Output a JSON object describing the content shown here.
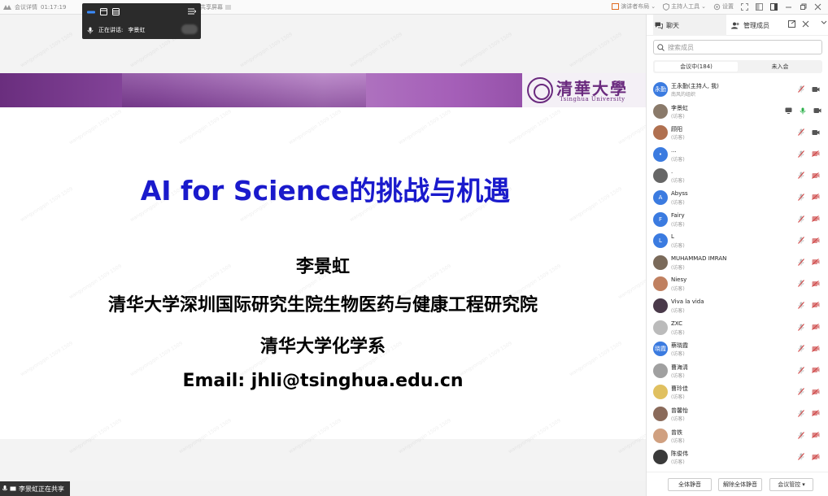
{
  "topbar": {
    "meeting_label": "会议详情",
    "timer": "01:17:19",
    "share_label": "共享屏幕",
    "layout_label": "演讲者布局",
    "host_tools_label": "主持人工具",
    "settings_label": "设置"
  },
  "speaker": {
    "label": "正在讲话:",
    "name": "李景虹"
  },
  "slide": {
    "title": "AI for Science的挑战与机遇",
    "author": "李景虹",
    "affiliation1": "清华大学深圳国际研究生院生物医药与健康工程研究院",
    "affiliation2": "清华大学化学系",
    "email": "Email: jhli@tsinghua.edu.cn",
    "logo_cn": "清華大學",
    "logo_en": "Tsinghua University",
    "banner_color": "#8a4aa0",
    "title_color": "#1a1acc"
  },
  "status": {
    "sharing_text": "李景虹正在共享"
  },
  "sidebar": {
    "tab_chat": "聊天",
    "tab_members": "管理成员",
    "search_placeholder": "搜索成员",
    "seg_in_meeting": "会议中(184)",
    "seg_not_joined": "未入会",
    "members": [
      {
        "avatar": "永勤",
        "name": "王永勤(主持人, 我)",
        "role": "南风的组织",
        "color": "#3b7be0",
        "video": true
      },
      {
        "avatar": "",
        "name": "李景虹",
        "role": "(访客)",
        "color": "#8a7a6a",
        "video": true,
        "active": true
      },
      {
        "avatar": "",
        "name": "顾阳",
        "role": "(访客)",
        "color": "#b07050",
        "video": true
      },
      {
        "avatar": "•",
        "name": "...",
        "role": "(访客)",
        "color": "#3b7be0"
      },
      {
        "avatar": "",
        "name": ".",
        "role": "(访客)",
        "color": "#666666"
      },
      {
        "avatar": "A",
        "name": "Abyss",
        "role": "(访客)",
        "color": "#3b7be0"
      },
      {
        "avatar": "F",
        "name": "Fairy",
        "role": "(访客)",
        "color": "#3b7be0"
      },
      {
        "avatar": "L",
        "name": "L",
        "role": "(访客)",
        "color": "#3b7be0"
      },
      {
        "avatar": "",
        "name": "MUHAMMAD IMRAN",
        "role": "(访客)",
        "color": "#7a6a5a"
      },
      {
        "avatar": "",
        "name": "Niesy",
        "role": "(访客)",
        "color": "#c08060"
      },
      {
        "avatar": "",
        "name": "Viva la vida",
        "role": "(访客)",
        "color": "#4a3a4a"
      },
      {
        "avatar": "",
        "name": "ZXC",
        "role": "(访客)",
        "color": "#bbbbbb"
      },
      {
        "avatar": "晓霞",
        "name": "蔡晓霞",
        "role": "(访客)",
        "color": "#3b7be0"
      },
      {
        "avatar": "",
        "name": "曹海清",
        "role": "(访客)",
        "color": "#a0a0a0"
      },
      {
        "avatar": "",
        "name": "曹玲佳",
        "role": "(访客)",
        "color": "#e0c060"
      },
      {
        "avatar": "",
        "name": "曾馨怡",
        "role": "(访客)",
        "color": "#8a6a5a"
      },
      {
        "avatar": "",
        "name": "曾铁",
        "role": "(访客)",
        "color": "#d0a080"
      },
      {
        "avatar": "",
        "name": "陈俊伟",
        "role": "(访客)",
        "color": "#3a3a3a"
      }
    ],
    "btn_mute_all": "全体静音",
    "btn_unmute_all": "解除全体静音",
    "btn_control": "会议管控",
    "mic_muted_color": "#d04040",
    "video_off_color": "#d04040"
  }
}
